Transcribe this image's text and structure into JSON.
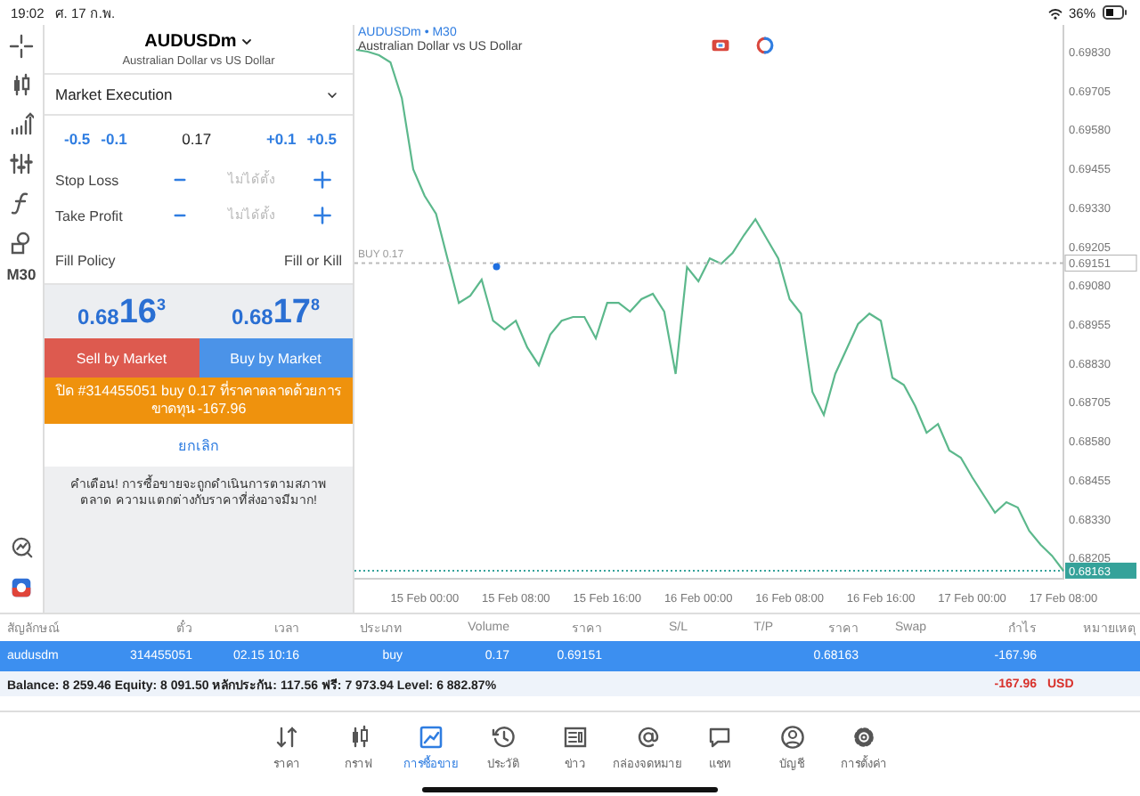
{
  "status_bar": {
    "time": "19:02",
    "date": "ศ. 17 ก.พ.",
    "battery": "36%"
  },
  "toolbar": {
    "timeframe": "M30"
  },
  "order": {
    "symbol": "AUDUSDm",
    "description": "Australian Dollar vs US Dollar",
    "execution": "Market Execution",
    "volume": {
      "decrease": [
        "-0.5",
        "-0.1"
      ],
      "value": "0.17",
      "increase": [
        "+0.1",
        "+0.5"
      ]
    },
    "stop_loss": {
      "label": "Stop Loss",
      "placeholder": "ไม่ได้ตั้ง"
    },
    "take_profit": {
      "label": "Take Profit",
      "placeholder": "ไม่ได้ตั้ง"
    },
    "fill_policy": {
      "label": "Fill Policy",
      "value": "Fill or Kill"
    },
    "bid": {
      "base": "0.68",
      "pips": "16",
      "point": "3"
    },
    "ask": {
      "base": "0.68",
      "pips": "17",
      "point": "8"
    },
    "sell_button": "Sell by Market",
    "buy_button": "Buy by Market",
    "notice": "ปิด #314455051 buy 0.17 ที่ราคาตลาดด้วยการขาดทุน -167.96",
    "cancel": "ยกเลิก",
    "warning": "คำเตือน! การซื้อขายจะถูกดำเนินการตามสภาพตลาด ความแตกต่างกับราคาที่ส่งอาจมีมาก!"
  },
  "chart": {
    "description": "Australian Dollar vs US Dollar",
    "chart_data": {
      "type": "line",
      "title": "AUDUSDm • M30",
      "series": [
        {
          "color": "#5cb88c",
          "values": [
            0.69836,
            0.6983,
            0.69819,
            0.69796,
            0.69681,
            0.69452,
            0.69367,
            0.69309,
            0.69166,
            0.69023,
            0.69046,
            0.69098,
            0.68966,
            0.68938,
            0.68966,
            0.6888,
            0.68823,
            0.68921,
            0.68966,
            0.68978,
            0.68978,
            0.68909,
            0.69023,
            0.69023,
            0.68995,
            0.69035,
            0.69052,
            0.68995,
            0.68795,
            0.69138,
            0.69092,
            0.69166,
            0.69149,
            0.69184,
            0.69241,
            0.69292,
            0.69229,
            0.69166,
            0.69035,
            0.68989,
            0.68737,
            0.68663,
            0.68795,
            0.68875,
            0.68955,
            0.68989,
            0.68966,
            0.68783,
            0.6876,
            0.68692,
            0.68606,
            0.68634,
            0.68549,
            0.68526,
            0.68463,
            0.68406,
            0.68349,
            0.68383,
            0.68366,
            0.68291,
            0.68246,
            0.68211,
            0.68163
          ]
        }
      ],
      "categories": [
        null,
        null,
        null,
        null,
        null,
        null,
        "15 Feb 00:00",
        null,
        null,
        null,
        null,
        null,
        null,
        null,
        "15 Feb 08:00",
        null,
        null,
        null,
        null,
        null,
        null,
        null,
        "15 Feb 16:00",
        null,
        null,
        null,
        null,
        null,
        null,
        null,
        "16 Feb 00:00",
        null,
        null,
        null,
        null,
        null,
        null,
        null,
        "16 Feb 08:00",
        null,
        null,
        null,
        null,
        null,
        null,
        null,
        "16 Feb 16:00",
        null,
        null,
        null,
        null,
        null,
        null,
        null,
        "17 Feb 00:00",
        null,
        null,
        null,
        null,
        null,
        null,
        null,
        "17 Feb 08:00"
      ],
      "ylim": [
        0.68137,
        0.69916
      ],
      "yticks": [
        {
          "value": 0.6983,
          "label": "0.69830"
        },
        {
          "value": 0.69705,
          "label": "0.69705"
        },
        {
          "value": 0.6958,
          "label": "0.69580"
        },
        {
          "value": 0.69455,
          "label": "0.69455"
        },
        {
          "value": 0.6933,
          "label": "0.69330"
        },
        {
          "value": 0.69205,
          "label": "0.69205"
        },
        {
          "value": 0.69151,
          "label": "0.69151"
        },
        {
          "value": 0.6908,
          "label": "0.69080"
        },
        {
          "value": 0.68955,
          "label": "0.68955"
        },
        {
          "value": 0.6883,
          "label": "0.68830"
        },
        {
          "value": 0.68705,
          "label": "0.68705"
        },
        {
          "value": 0.6858,
          "label": "0.68580"
        },
        {
          "value": 0.68455,
          "label": "0.68455"
        },
        {
          "value": 0.6833,
          "label": "0.68330"
        },
        {
          "value": 0.68205,
          "label": "0.68205"
        },
        {
          "value": 0.68163,
          "label": "0.68163"
        }
      ],
      "ref_lines": [
        {
          "axis": "y",
          "value": 0.69151,
          "label": "BUY 0.17",
          "color": "#bbbbbb"
        },
        {
          "axis": "y",
          "value": 0.68163,
          "color": "#35a29a"
        }
      ]
    }
  },
  "trades": {
    "columns": [
      "สัญลักษณ์",
      "ตั๋ว",
      "เวลา",
      "ประเภท",
      "Volume",
      "ราคา",
      "S/L",
      "T/P",
      "ราคา",
      "Swap",
      "กำไร",
      "หมายเหตุ"
    ],
    "rows": [
      {
        "selected": true,
        "cells": [
          "audusdm",
          "314455051",
          "02.15 10:16",
          "buy",
          "0.17",
          "0.69151",
          null,
          null,
          "0.68163",
          null,
          "-167.96",
          null
        ]
      }
    ],
    "summary": {
      "text": "Balance: 8 259.46 Equity: 8 091.50 หลักประกัน: 117.56 ฟรี: 7 973.94 Level: 6 882.87%",
      "profit": "-167.96",
      "currency": "USD"
    }
  },
  "nav": [
    {
      "kind": "quotes",
      "label": "ราคา",
      "selected": false
    },
    {
      "kind": "chart",
      "label": "กราฟ",
      "selected": false
    },
    {
      "kind": "trade",
      "label": "การซื้อขาย",
      "selected": true
    },
    {
      "kind": "history",
      "label": "ประวัติ",
      "selected": false
    },
    {
      "kind": "news",
      "label": "ข่าว",
      "selected": false
    },
    {
      "kind": "mail",
      "label": "กล่องจดหมาย",
      "selected": false
    },
    {
      "kind": "chat",
      "label": "แชท",
      "selected": false
    },
    {
      "kind": "account",
      "label": "บัญชี",
      "selected": false
    },
    {
      "kind": "settings",
      "label": "การตั้งค่า",
      "selected": false
    }
  ]
}
